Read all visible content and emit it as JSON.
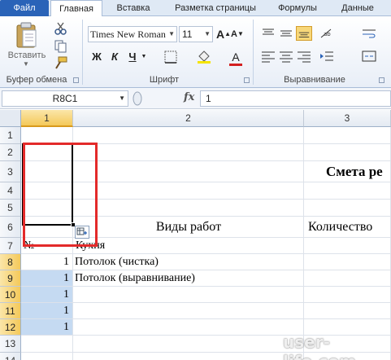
{
  "ribbon_tabs": [
    "Файл",
    "Главная",
    "Вставка",
    "Разметка страницы",
    "Формулы",
    "Данные"
  ],
  "ribbon": {
    "clipboard": {
      "paste_label": "Вставить",
      "group_label": "Буфер обмена"
    },
    "font": {
      "font_name": "Times New Roman",
      "font_size": "11",
      "bold": "Ж",
      "italic": "К",
      "underline": "Ч",
      "grow": "A",
      "shrink": "A",
      "group_label": "Шрифт"
    },
    "alignment": {
      "group_label": "Выравнивание"
    }
  },
  "formula_bar": {
    "name_box": "R8C1",
    "fx": "fx",
    "value": "1"
  },
  "columns": [
    "1",
    "2",
    "3"
  ],
  "rows": [
    "1",
    "2",
    "3",
    "4",
    "5",
    "6",
    "7",
    "8",
    "9",
    "10",
    "11",
    "12",
    "13",
    "14"
  ],
  "cells": {
    "r3_title": "Смета ре",
    "r6_works": "Виды работ",
    "r6_qty": "Количество",
    "r7_num": "№",
    "r7_kitchen": "Кухня",
    "r8_val": "1",
    "r8_text": "Потолок (чистка)",
    "r9_val": "1",
    "r9_text": "Потолок (выравнивание)",
    "r10_val": "1",
    "r11_val": "1",
    "r12_val": "1"
  },
  "colors": {
    "accent": "#2a63b8",
    "selection": "#c5daf2",
    "highlight": "#e32a2a"
  },
  "watermark": "user-life.com"
}
